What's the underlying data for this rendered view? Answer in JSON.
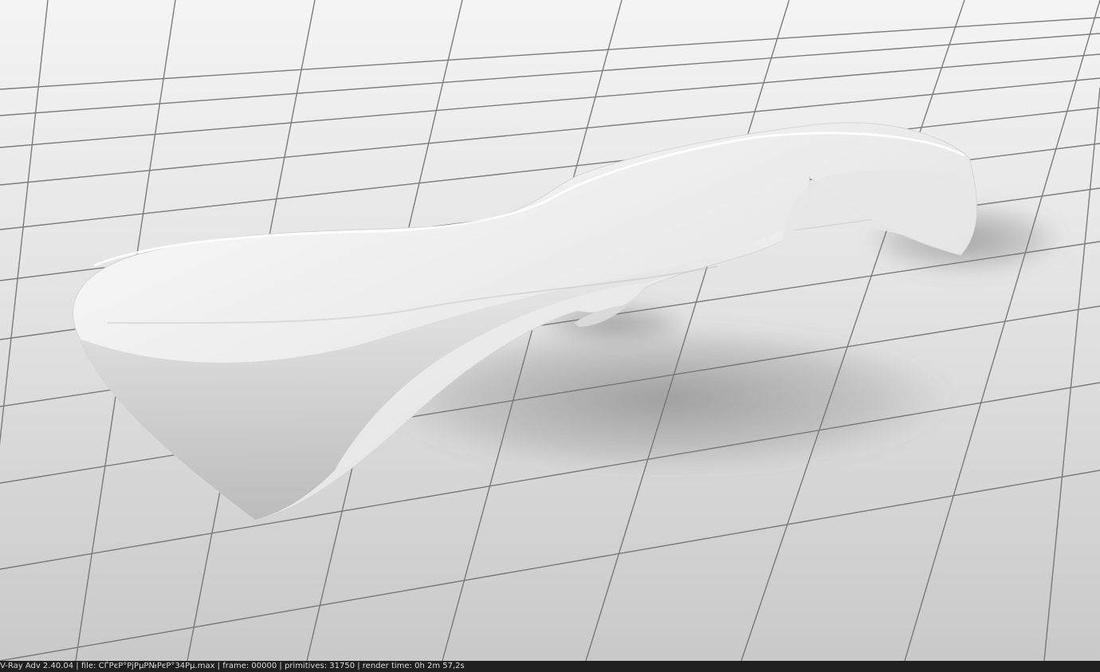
{
  "render_window": {
    "status_text": "V-Ray Adv 2.40.04 | file: СЃРєР°РјРµР№РєР°34Рµ.max | frame: 00000 | primitives: 31750 | render time:  0h  2m 57,2s"
  },
  "scene": {
    "object": "bench-icon",
    "floor": "tiled-floor",
    "colors": {
      "floor_light": "#f2f2f2",
      "floor_dark": "#c7c7c7",
      "grid_line": "#6f6f6f",
      "bench_white": "#f4f4f4",
      "bench_shadow": "#8f8f8f",
      "status_bg": "#1f1f1f",
      "status_text": "#dcdcdc"
    }
  }
}
